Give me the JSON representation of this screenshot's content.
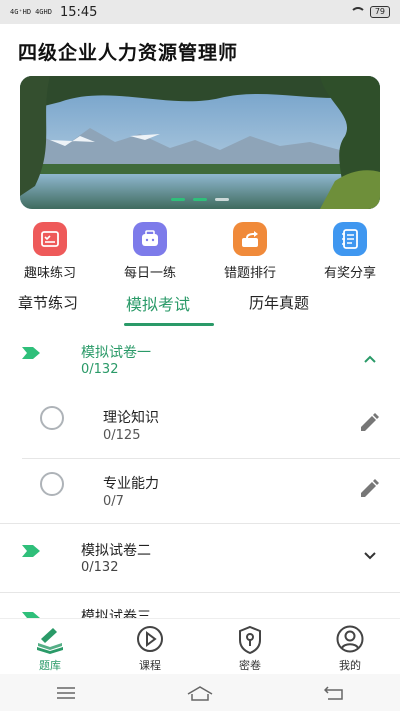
{
  "status_bar": {
    "signal_1": "4G⁺HD",
    "signal_2": "4GHD",
    "time": "15:45",
    "battery": "79"
  },
  "page_title": "四级企业人力资源管理师",
  "banner": {
    "slide_count": 3,
    "active_slide": 1
  },
  "tiles": [
    {
      "label": "趣味练习",
      "icon": "clipboard-check-icon",
      "color": "#ee5a5a"
    },
    {
      "label": "每日一练",
      "icon": "briefcase-icon",
      "color": "#7d7bea"
    },
    {
      "label": "错题排行",
      "icon": "share-box-icon",
      "color": "#f08a3a"
    },
    {
      "label": "有奖分享",
      "icon": "notebook-icon",
      "color": "#3f97f0"
    }
  ],
  "tabs": [
    {
      "label": "章节练习",
      "active": false
    },
    {
      "label": "模拟考试",
      "active": true
    },
    {
      "label": "历年真题",
      "active": false
    }
  ],
  "papers": [
    {
      "title": "模拟试卷一",
      "count": "0/132",
      "expanded": true,
      "subsections": [
        {
          "title": "理论知识",
          "count": "0/125"
        },
        {
          "title": "专业能力",
          "count": "0/7"
        }
      ]
    },
    {
      "title": "模拟试卷二",
      "count": "0/132",
      "expanded": false
    },
    {
      "title": "模拟试卷三",
      "count": "",
      "expanded": false
    }
  ],
  "bottom_nav": [
    {
      "label": "题库",
      "icon": "books-icon",
      "active": true
    },
    {
      "label": "课程",
      "icon": "play-circle-icon",
      "active": false
    },
    {
      "label": "密卷",
      "icon": "lock-shield-icon",
      "active": false
    },
    {
      "label": "我的",
      "icon": "user-icon",
      "active": false
    }
  ],
  "colors": {
    "accent": "#2a9a68",
    "flag": "#2fbf7a"
  }
}
